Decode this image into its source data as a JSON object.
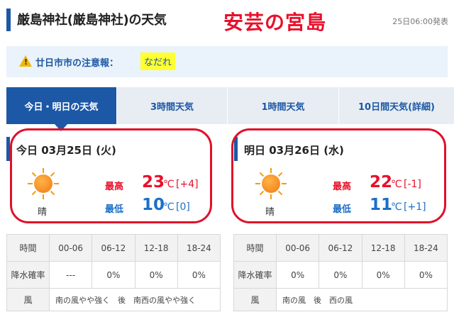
{
  "header": {
    "title": "厳島神社(厳島神社)の天気",
    "overlay_caption": "安芸の宮島",
    "published": "25日06:00発表"
  },
  "warning": {
    "label": "廿日市市の注意報：",
    "value": "なだれ",
    "icon": "warning-icon"
  },
  "tabs": [
    {
      "label": "今日・明日の天気",
      "active": true
    },
    {
      "label": "3時間天気",
      "active": false
    },
    {
      "label": "1時間天気",
      "active": false
    },
    {
      "label": "10日間天気(詳細)",
      "active": false
    }
  ],
  "today": {
    "heading": "今日 03月25日 (火)",
    "weather": "晴",
    "icon": "sun-icon",
    "high_label": "最高",
    "high": "23",
    "high_diff": "[+4]",
    "low_label": "最低",
    "low": "10",
    "low_diff": "[0]",
    "unit": "℃",
    "table": {
      "header": [
        "時間",
        "00-06",
        "06-12",
        "12-18",
        "18-24"
      ],
      "rain_label": "降水確率",
      "rain": [
        "---",
        "0%",
        "0%",
        "0%"
      ],
      "wind_label": "風",
      "wind": "南の風やや強く　後　南西の風やや強く"
    }
  },
  "tomorrow": {
    "heading": "明日 03月26日 (水)",
    "weather": "晴",
    "icon": "sun-icon",
    "high_label": "最高",
    "high": "22",
    "high_diff": "[-1]",
    "low_label": "最低",
    "low": "11",
    "low_diff": "[+1]",
    "unit": "℃",
    "table": {
      "header": [
        "時間",
        "00-06",
        "06-12",
        "12-18",
        "18-24"
      ],
      "rain_label": "降水確率",
      "rain": [
        "0%",
        "0%",
        "0%",
        "0%"
      ],
      "wind_label": "風",
      "wind": "南の風　後　西の風"
    }
  },
  "colors": {
    "brand_blue": "#1c58a6",
    "high_red": "#e8102a",
    "low_blue": "#1c6fc8",
    "warning_highlight": "#ffff33"
  }
}
